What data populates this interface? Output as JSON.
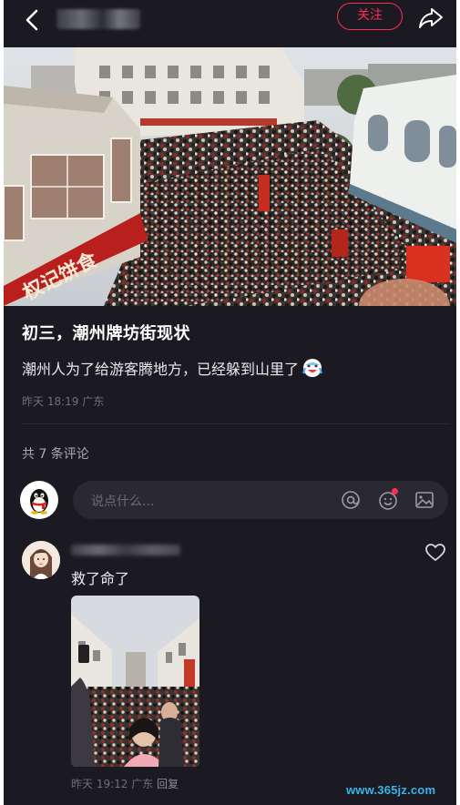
{
  "header": {
    "back_icon": "chevron-left-icon",
    "follow_label": "关注",
    "share_icon": "share-arrow-icon",
    "accent_color": "#ff2e4f"
  },
  "post": {
    "photo_sign_text": "权记饼食",
    "title": "初三，潮州牌坊街现状",
    "body": "潮州人为了给游客腾地方，已经躲到山里了",
    "body_emoji": "crying-laughing-emoji-icon",
    "meta": "昨天 18:19 广东"
  },
  "comments_header": {
    "count_label": "共 7 条评论"
  },
  "composer": {
    "placeholder": "说点什么...",
    "icons": [
      "at-icon",
      "emoji-icon",
      "image-icon"
    ]
  },
  "comments": [
    {
      "text": "救了命了",
      "meta": "昨天 19:12 广东",
      "reply_label": "回复",
      "like_icon": "heart-outline-icon"
    }
  ],
  "watermark": "www.365jz.com"
}
